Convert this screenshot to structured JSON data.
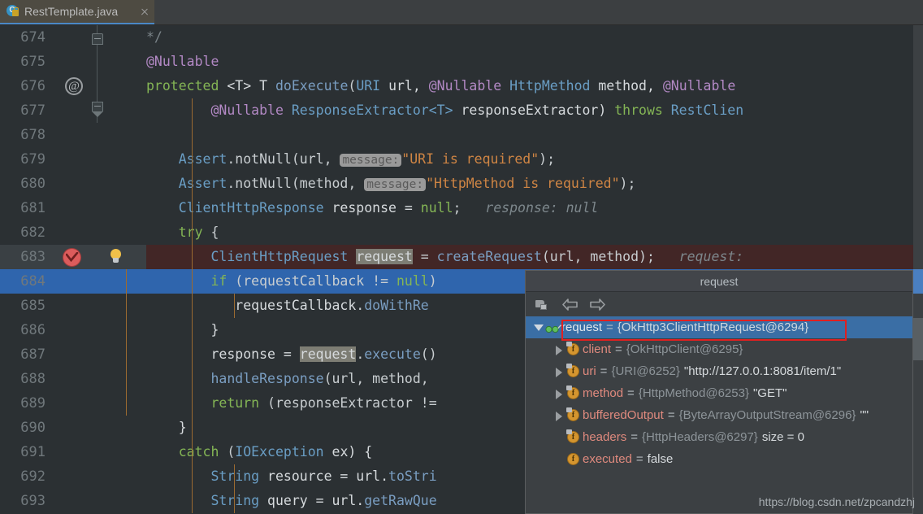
{
  "tab": {
    "title": "RestTemplate.java",
    "icon": "java-class-icon",
    "close_icon": "close-icon"
  },
  "editor": {
    "lines": [
      {
        "num": "674",
        "text": "        */"
      },
      {
        "num": "675",
        "text": "        @Nullable"
      },
      {
        "num": "676",
        "text": "        protected <T> T doExecute(URI url, @Nullable HttpMethod method, @Nullable"
      },
      {
        "num": "677",
        "text": "                @Nullable ResponseExtractor<T> responseExtractor) throws RestClien"
      },
      {
        "num": "678",
        "text": ""
      },
      {
        "num": "679",
        "text": "            Assert.notNull(url,  message: \"URI is required\");"
      },
      {
        "num": "680",
        "text": "            Assert.notNull(method,  message: \"HttpMethod is required\");"
      },
      {
        "num": "681",
        "text": "            ClientHttpResponse response = null;   response: null"
      },
      {
        "num": "682",
        "text": "            try {"
      },
      {
        "num": "683",
        "text": "                ClientHttpRequest request = createRequest(url, method);   request:"
      },
      {
        "num": "684",
        "text": "                if (requestCallback != null)"
      },
      {
        "num": "685",
        "text": "                    requestCallback.doWithRe"
      },
      {
        "num": "686",
        "text": "                }"
      },
      {
        "num": "687",
        "text": "                response = request.execute()"
      },
      {
        "num": "688",
        "text": "                handleResponse(url, method,"
      },
      {
        "num": "689",
        "text": "                return (responseExtractor !="
      },
      {
        "num": "690",
        "text": "            }"
      },
      {
        "num": "691",
        "text": "            catch (IOException ex) {"
      },
      {
        "num": "692",
        "text": "                String resource = url.toStri"
      },
      {
        "num": "693",
        "text": "                String query = url.getRawQue"
      }
    ],
    "tokens": {
      "l674_comment": "*/",
      "l675_annotation": "@Nullable",
      "l676_protected": "protected",
      "l676_generic": "<T>",
      "l676_T": "T",
      "l676_method": "doExecute",
      "l676_uri": "URI",
      "l676_url": "url,",
      "l676_ann2": "@Nullable",
      "l676_httpmethod": "HttpMethod",
      "l676_methodparam": "method,",
      "l676_ann3": "@Nullable",
      "l677_ann": "@Nullable",
      "l677_type": "ResponseExtractor<T>",
      "l677_param": "responseExtractor)",
      "l677_throws": "throws",
      "l677_exc": "RestClien",
      "l679_assert": "Assert",
      "l679_call": ".notNull(url, ",
      "l679_hint": "message:",
      "l679_str": "\"URI is required\"",
      "l679_end": ");",
      "l680_assert": "Assert",
      "l680_call": ".notNull(method, ",
      "l680_hint": "message:",
      "l680_str": "\"HttpMethod is required\"",
      "l680_end": ");",
      "l681_type": "ClientHttpResponse",
      "l681_var": " response = ",
      "l681_null": "null",
      "l681_semi": ";",
      "l681_dbg": "response: null",
      "l682_try": "try",
      "l682_brace": " {",
      "l683_type": "ClientHttpRequest",
      "l683_hl": "request",
      "l683_mid": " = ",
      "l683_call": "createRequest",
      "l683_args": "(url, method);",
      "l683_dbg": "request:",
      "l684_if": "if",
      "l684_cond": " (requestCallback != ",
      "l684_null": "null",
      "l684_close": ")",
      "l685_obj": "requestCallback",
      "l685_dot": ".",
      "l685_mth": "doWithRe",
      "l686_brace": "}",
      "l687_resp": "response = ",
      "l687_hl": "request",
      "l687_dot": ".",
      "l687_mth": "execute",
      "l687_paren": "()",
      "l688_mth": "handleResponse",
      "l688_args": "(url, method,",
      "l689_return": "return",
      "l689_rest": " (responseExtractor !=",
      "l690_brace": "}",
      "l691_catch": "catch",
      "l691_open": " (",
      "l691_exc": "IOException",
      "l691_ex": " ex) {",
      "l692_type": "String",
      "l692_var": " resource = url.",
      "l692_mth": "toStri",
      "l693_type": "String",
      "l693_var": " query = url.",
      "l693_mth": "getRawQue"
    },
    "gutter": {
      "override_marker": "@",
      "breakpoint_icon": "breakpoint-verified-icon",
      "intention_icon": "intention-bulb-icon",
      "fold_icon": "fold-marker-icon"
    }
  },
  "popup": {
    "title": "request",
    "toolbar": [
      {
        "name": "new-watch-icon",
        "label": ""
      },
      {
        "name": "back-arrow-icon",
        "label": ""
      },
      {
        "name": "forward-arrow-icon",
        "label": ""
      }
    ],
    "variables": [
      {
        "expandable": true,
        "expanded": true,
        "selected": true,
        "icon": "watch-glasses-icon",
        "indent": 0,
        "name": "request",
        "eq": "=",
        "type": "{OkHttp3ClientHttpRequest@6294}",
        "value": ""
      },
      {
        "expandable": true,
        "expanded": false,
        "selected": false,
        "icon": "field-final-icon",
        "indent": 1,
        "name": "client",
        "eq": "=",
        "type": "{OkHttpClient@6295}",
        "value": ""
      },
      {
        "expandable": true,
        "expanded": false,
        "selected": false,
        "icon": "field-final-icon",
        "indent": 1,
        "name": "uri",
        "eq": "=",
        "type": "{URI@6252}",
        "value": "\"http://127.0.0.1:8081/item/1\""
      },
      {
        "expandable": true,
        "expanded": false,
        "selected": false,
        "icon": "field-final-icon",
        "indent": 1,
        "name": "method",
        "eq": "=",
        "type": "{HttpMethod@6253}",
        "value": "\"GET\""
      },
      {
        "expandable": true,
        "expanded": false,
        "selected": false,
        "icon": "field-final-icon",
        "indent": 1,
        "name": "bufferedOutput",
        "eq": "=",
        "type": "{ByteArrayOutputStream@6296}",
        "value": "\"\""
      },
      {
        "expandable": false,
        "expanded": false,
        "selected": false,
        "icon": "field-final-icon",
        "indent": 1,
        "name": "headers",
        "eq": "=",
        "type": "{HttpHeaders@6297}",
        "value": "size = 0"
      },
      {
        "expandable": false,
        "expanded": false,
        "selected": false,
        "icon": "field-icon",
        "indent": 1,
        "name": "executed",
        "eq": "=",
        "type": "",
        "value": "false"
      }
    ]
  },
  "watermark": "https://blog.csdn.net/zpcandzhj",
  "colors": {
    "editor_bg": "#2b3033",
    "current_line": "#2f65ad",
    "breakpoint_line": "#422626",
    "accent_tab": "#4a88c7",
    "annotation_rect": "#e02020",
    "field_icon": "#d4952f",
    "var_name": "#e08a7e"
  }
}
